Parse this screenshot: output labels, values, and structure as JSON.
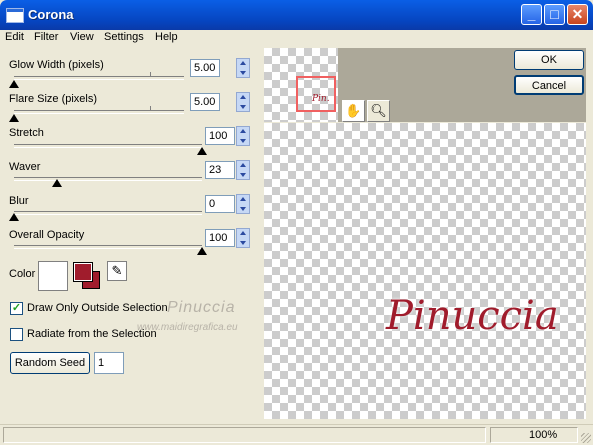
{
  "window": {
    "title": "Corona"
  },
  "menu": [
    "Edit",
    "Filter",
    "View",
    "Settings",
    "Help"
  ],
  "sliders": [
    {
      "label": "Glow Width (pixels)",
      "value": "5.00",
      "level": 0.0
    },
    {
      "label": "Flare Size (pixels)",
      "value": "5.00",
      "level": 0.0
    },
    {
      "label": "Stretch",
      "value": "100",
      "level": 1.0
    },
    {
      "label": "Waver",
      "value": "23",
      "level": 0.23
    },
    {
      "label": "Blur",
      "value": "0",
      "level": 0.0
    },
    {
      "label": "Overall Opacity",
      "value": "100",
      "level": 1.0
    }
  ],
  "color": {
    "label": "Color",
    "primary": "#ffffff",
    "secondary": "#a01c2c"
  },
  "options": {
    "draw_only_outside": {
      "label": "Draw Only Outside Selection",
      "checked": true
    },
    "radiate": {
      "label": "Radiate from the Selection",
      "checked": false
    }
  },
  "random_seed": {
    "label": "Random Seed",
    "value": "1"
  },
  "buttons": {
    "ok": "OK",
    "cancel": "Cancel"
  },
  "watermark": {
    "name": "Pinuccia",
    "url": "www.maidiregrafica.eu"
  },
  "preview": {
    "thumb_text": "Pin.",
    "text": "Pinuccia",
    "text_color": "#a01c2c"
  },
  "status": {
    "zoom": "100%"
  }
}
